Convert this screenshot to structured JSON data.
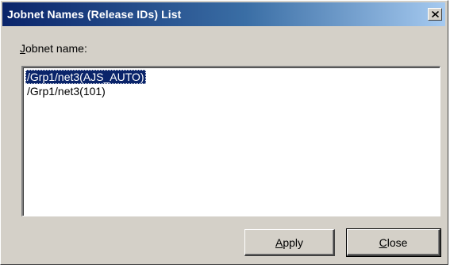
{
  "window": {
    "title": "Jobnet Names (Release IDs) List",
    "close_glyph": "×"
  },
  "field": {
    "label_mnemonic": "J",
    "label_rest": "obnet name:"
  },
  "list": {
    "items": [
      {
        "label": "/Grp1/net3(AJS_AUTO)",
        "selected": true
      },
      {
        "label": "/Grp1/net3(101)",
        "selected": false
      }
    ]
  },
  "buttons": {
    "apply_mnemonic": "A",
    "apply_rest": "pply",
    "close_mnemonic": "C",
    "close_rest": "lose"
  },
  "colors": {
    "titlebar_start": "#0a246a",
    "titlebar_end": "#a6caf0",
    "face": "#d4d0c8",
    "selection": "#0a246a"
  },
  "icons": {
    "close": "close-icon"
  }
}
